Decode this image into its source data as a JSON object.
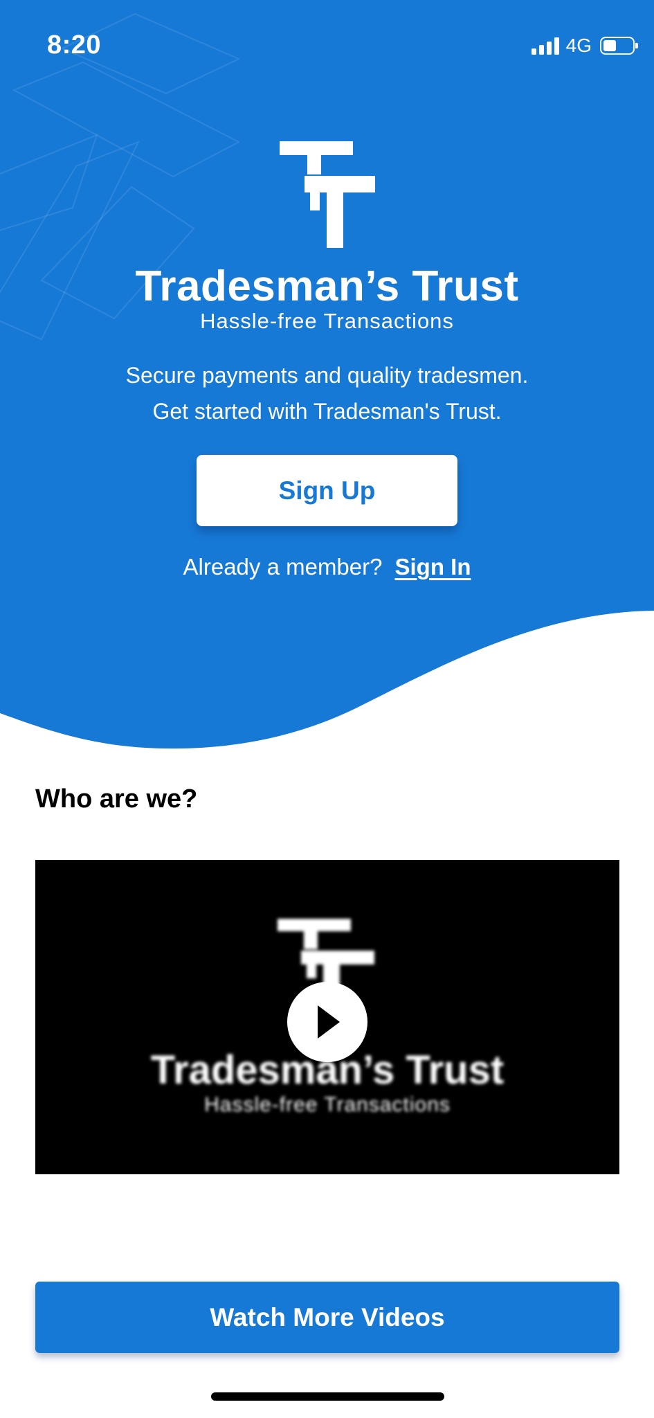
{
  "colors": {
    "brand_blue": "#1779d6",
    "white": "#ffffff",
    "black": "#000000"
  },
  "status_bar": {
    "time": "8:20",
    "network": "4G",
    "signal_icon": "cellular-signal-icon",
    "battery_icon": "battery-icon",
    "battery_level": 0.45
  },
  "hero": {
    "logo_icon": "tradesmans-trust-logo-icon",
    "brand_name": "Tradesman’s Trust",
    "tagline": "Hassle-free Transactions",
    "intro_line_1": "Secure payments and quality tradesmen.",
    "intro_line_2": "Get started with Tradesman's Trust.",
    "signup_label": "Sign Up",
    "member_prompt": "Already a member?",
    "signin_label": "Sign In"
  },
  "about": {
    "heading": "Who are we?",
    "video": {
      "brand_name": "Tradesman’s Trust",
      "tagline": "Hassle-free Transactions",
      "play_icon": "play-icon"
    },
    "watch_more_label": "Watch More Videos"
  }
}
